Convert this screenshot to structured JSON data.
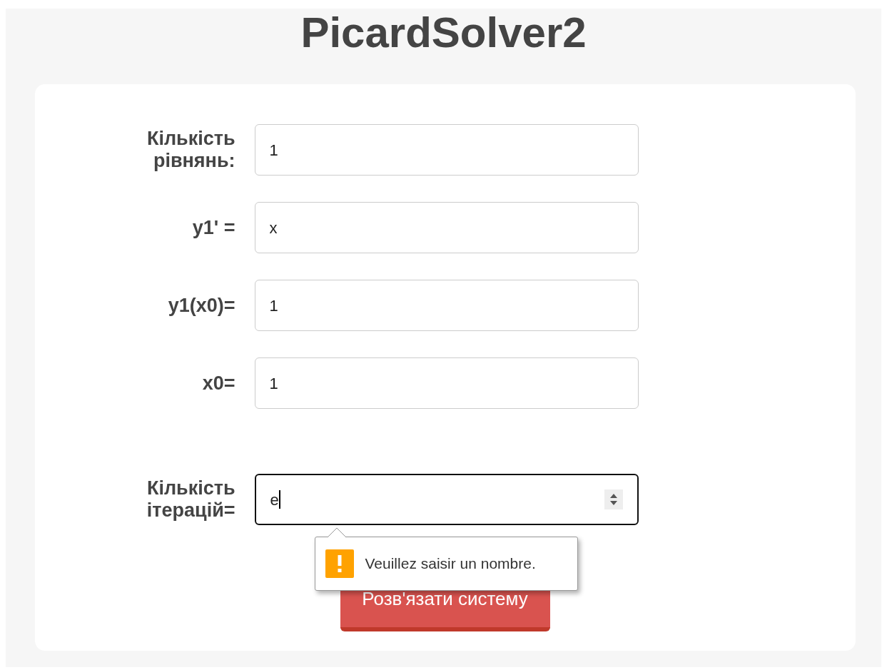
{
  "title": "PicardSolver2",
  "fields": [
    {
      "label": "Кількість рівнянь:",
      "value": "1",
      "kind": "text",
      "focused": false
    },
    {
      "label": "y1' =",
      "value": "x",
      "kind": "text",
      "focused": false
    },
    {
      "label": "y1(x0)=",
      "value": "1",
      "kind": "text",
      "focused": false
    },
    {
      "label": "x0=",
      "value": "1",
      "kind": "text",
      "focused": false
    },
    {
      "label": "Кількість ітерацій=",
      "value": "e",
      "kind": "number",
      "focused": true
    }
  ],
  "validation_message": "Veuillez saisir un nombre.",
  "submit_button": "Розв'язати систему"
}
